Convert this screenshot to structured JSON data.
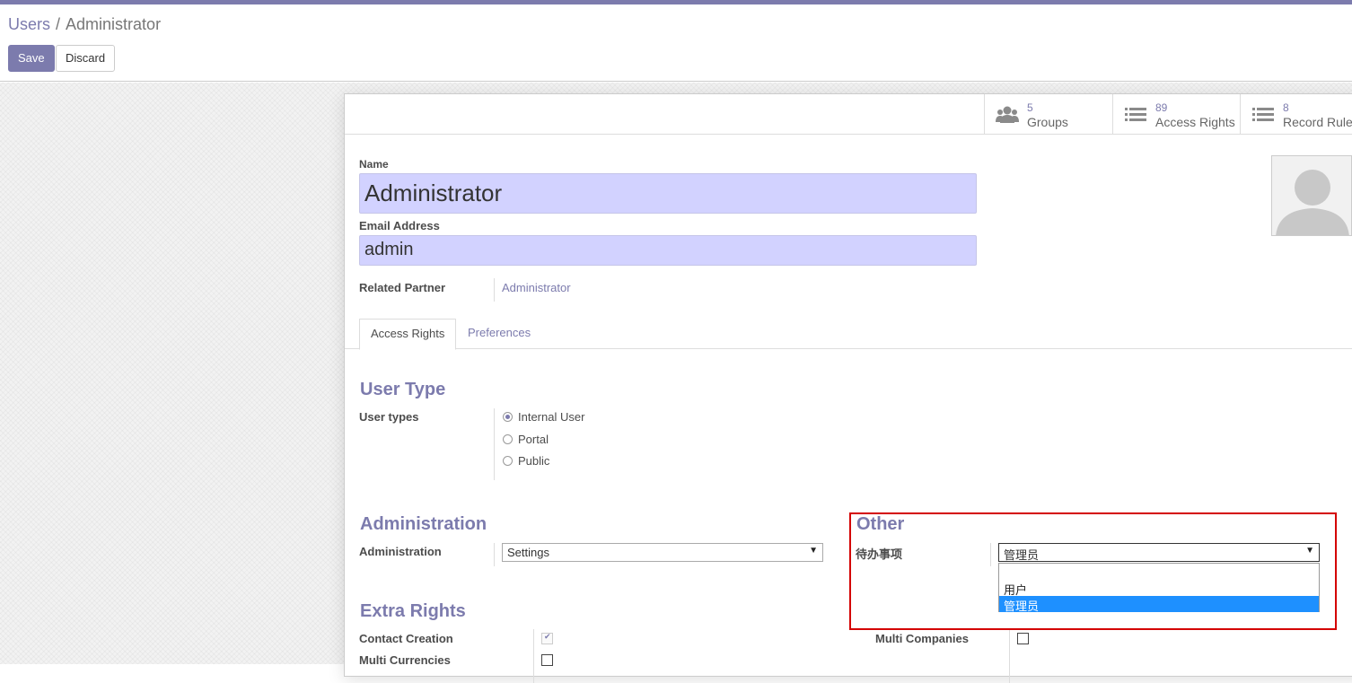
{
  "breadcrumb": {
    "parent": "Users",
    "separator": "/",
    "current": "Administrator"
  },
  "buttons": {
    "save": "Save",
    "discard": "Discard"
  },
  "stats": [
    {
      "count": "5",
      "label": "Groups",
      "icon": "users-icon"
    },
    {
      "count": "89",
      "label": "Access Rights",
      "icon": "list-icon"
    },
    {
      "count": "8",
      "label": "Record Rules",
      "icon": "list-icon"
    }
  ],
  "form": {
    "name_label": "Name",
    "name_value": "Administrator",
    "email_label": "Email Address",
    "email_value": "admin",
    "partner_label": "Related Partner",
    "partner_value": "Administrator"
  },
  "tabs": [
    {
      "label": "Access Rights",
      "active": true
    },
    {
      "label": "Preferences",
      "active": false
    }
  ],
  "user_type": {
    "title": "User Type",
    "label": "User types",
    "options": [
      {
        "label": "Internal User",
        "selected": true
      },
      {
        "label": "Portal",
        "selected": false
      },
      {
        "label": "Public",
        "selected": false
      }
    ]
  },
  "administration": {
    "title": "Administration",
    "label": "Administration",
    "value": "Settings"
  },
  "other": {
    "title": "Other",
    "label": "待办事项",
    "value": "管理员",
    "options": [
      {
        "label": "",
        "selected": false
      },
      {
        "label": "用户",
        "selected": false
      },
      {
        "label": "管理员",
        "selected": true
      }
    ]
  },
  "extra_rights": {
    "title": "Extra Rights",
    "items": [
      {
        "label": "Contact Creation",
        "checked": true
      },
      {
        "label": "Multi Currencies",
        "checked": false
      },
      {
        "label": "Multi Companies",
        "checked": false
      }
    ]
  },
  "colors": {
    "brand": "#7c7bad",
    "input_bg": "#d2d2ff",
    "highlight": "#d40000",
    "option_selected": "#1e90ff"
  }
}
